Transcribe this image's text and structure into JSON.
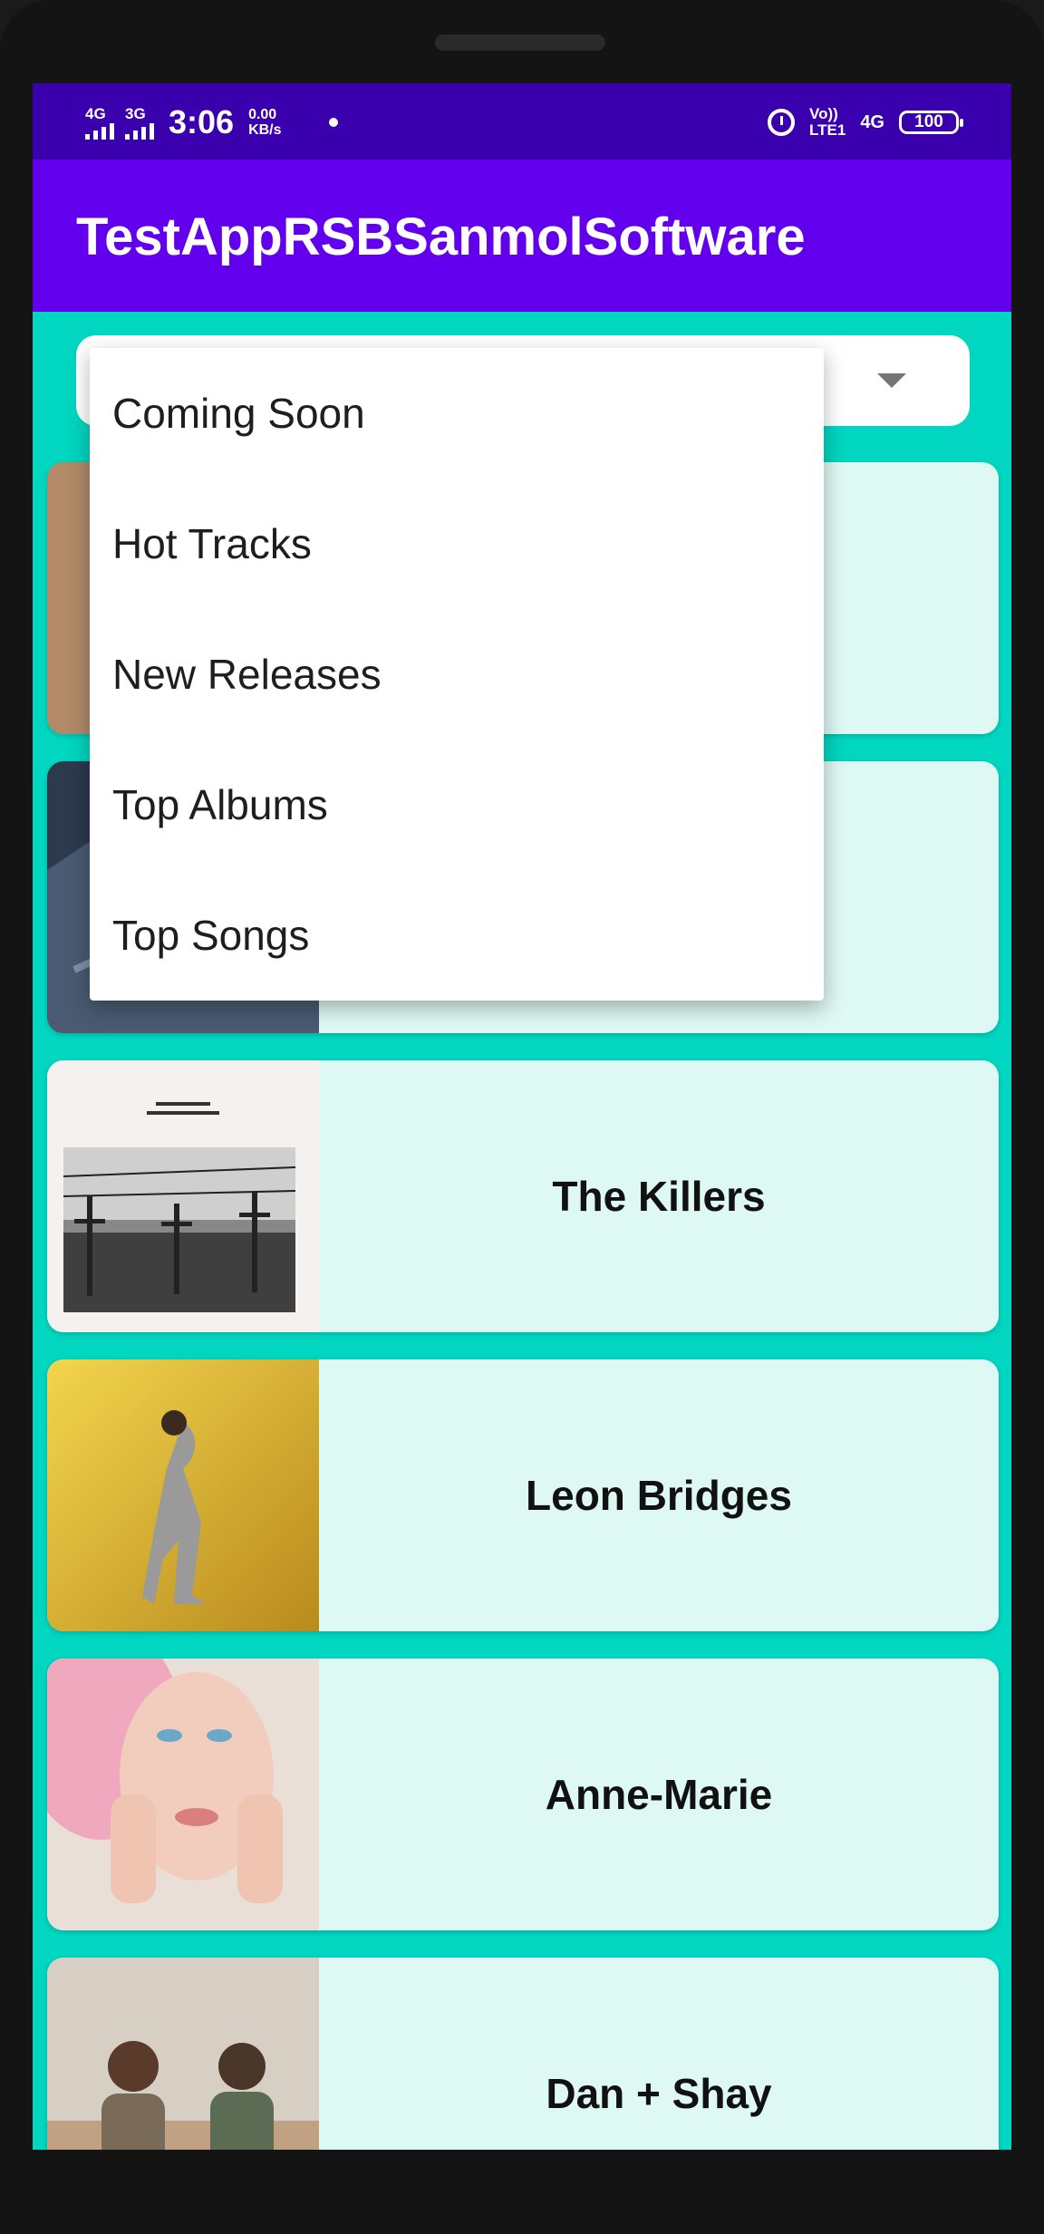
{
  "status_bar": {
    "signal1_label": "4G",
    "signal2_label": "3G",
    "time": "3:06",
    "net_speed_value": "0.00",
    "net_speed_unit": "KB/s",
    "volte_top": "Vo))",
    "volte_bottom": "LTE1",
    "network_type": "4G",
    "battery": "100"
  },
  "app_bar": {
    "title": "TestAppRSBSanmolSoftware"
  },
  "dropdown": {
    "options": [
      "Coming Soon",
      "Hot Tracks",
      "New Releases",
      "Top Albums",
      "Top Songs"
    ]
  },
  "list": {
    "items": [
      {
        "artist": ""
      },
      {
        "artist": ""
      },
      {
        "artist": "The Killers"
      },
      {
        "artist": "Leon Bridges"
      },
      {
        "artist": "Anne-Marie"
      },
      {
        "artist": "Dan + Shay"
      }
    ]
  },
  "colors": {
    "status_bar": "#3b00ad",
    "app_bar": "#6200ee",
    "background": "#00d6c0",
    "card": "#def8f4"
  }
}
